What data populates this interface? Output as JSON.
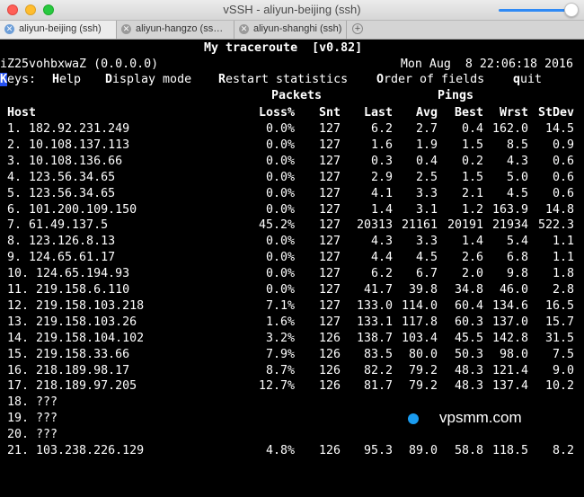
{
  "window": {
    "title": "vSSH - aliyun-beijing (ssh)",
    "tabs": [
      {
        "label": "aliyun-beijing (ssh)",
        "active": true
      },
      {
        "label": "aliyun-hangzo (ss…",
        "active": false
      },
      {
        "label": "aliyun-shanghi (ssh)",
        "active": false
      }
    ]
  },
  "terminal": {
    "heading": "My traceroute  [v0.82]",
    "host_line": "iZ25vohbxwaZ (0.0.0.0)",
    "datetime": "Mon Aug  8 22:06:18 2016",
    "keys": {
      "label_first": "K",
      "label_rest": "eys:",
      "help_key": "H",
      "help_rest": "elp",
      "display_key": "D",
      "display_rest": "isplay mode",
      "restart_key": "R",
      "restart_rest": "estart statistics",
      "order_key": "O",
      "order_rest": "rder of fields",
      "quit_key": "q",
      "quit_rest": "uit"
    },
    "group_headers": {
      "packets": "Packets",
      "pings": "Pings"
    },
    "columns": {
      "host": "Host",
      "loss": "Loss%",
      "snt": "Snt",
      "last": "Last",
      "avg": "Avg",
      "best": "Best",
      "wrst": "Wrst",
      "stdev": "StDev"
    },
    "hops": [
      {
        "host": "1. 182.92.231.249",
        "loss": "0.0%",
        "snt": "127",
        "last": "6.2",
        "avg": "2.7",
        "best": "0.4",
        "wrst": "162.0",
        "stdev": "14.5"
      },
      {
        "host": "2. 10.108.137.113",
        "loss": "0.0%",
        "snt": "127",
        "last": "1.6",
        "avg": "1.9",
        "best": "1.5",
        "wrst": "8.5",
        "stdev": "0.9"
      },
      {
        "host": "3. 10.108.136.66",
        "loss": "0.0%",
        "snt": "127",
        "last": "0.3",
        "avg": "0.4",
        "best": "0.2",
        "wrst": "4.3",
        "stdev": "0.6"
      },
      {
        "host": "4. 123.56.34.65",
        "loss": "0.0%",
        "snt": "127",
        "last": "2.9",
        "avg": "2.5",
        "best": "1.5",
        "wrst": "5.0",
        "stdev": "0.6"
      },
      {
        "host": "5. 123.56.34.65",
        "loss": "0.0%",
        "snt": "127",
        "last": "4.1",
        "avg": "3.3",
        "best": "2.1",
        "wrst": "4.5",
        "stdev": "0.6"
      },
      {
        "host": "6. 101.200.109.150",
        "loss": "0.0%",
        "snt": "127",
        "last": "1.4",
        "avg": "3.1",
        "best": "1.2",
        "wrst": "163.9",
        "stdev": "14.8"
      },
      {
        "host": "7. 61.49.137.5",
        "loss": "45.2%",
        "snt": "127",
        "last": "20313",
        "avg": "21161",
        "best": "20191",
        "wrst": "21934",
        "stdev": "522.3"
      },
      {
        "host": "8. 123.126.8.13",
        "loss": "0.0%",
        "snt": "127",
        "last": "4.3",
        "avg": "3.3",
        "best": "1.4",
        "wrst": "5.4",
        "stdev": "1.1"
      },
      {
        "host": "9. 124.65.61.17",
        "loss": "0.0%",
        "snt": "127",
        "last": "4.4",
        "avg": "4.5",
        "best": "2.6",
        "wrst": "6.8",
        "stdev": "1.1"
      },
      {
        "host": "10. 124.65.194.93",
        "loss": "0.0%",
        "snt": "127",
        "last": "6.2",
        "avg": "6.7",
        "best": "2.0",
        "wrst": "9.8",
        "stdev": "1.8"
      },
      {
        "host": "11. 219.158.6.110",
        "loss": "0.0%",
        "snt": "127",
        "last": "41.7",
        "avg": "39.8",
        "best": "34.8",
        "wrst": "46.0",
        "stdev": "2.8"
      },
      {
        "host": "12. 219.158.103.218",
        "loss": "7.1%",
        "snt": "127",
        "last": "133.0",
        "avg": "114.0",
        "best": "60.4",
        "wrst": "134.6",
        "stdev": "16.5"
      },
      {
        "host": "13. 219.158.103.26",
        "loss": "1.6%",
        "snt": "127",
        "last": "133.1",
        "avg": "117.8",
        "best": "60.3",
        "wrst": "137.0",
        "stdev": "15.7"
      },
      {
        "host": "14. 219.158.104.102",
        "loss": "3.2%",
        "snt": "126",
        "last": "138.7",
        "avg": "103.4",
        "best": "45.5",
        "wrst": "142.8",
        "stdev": "31.5"
      },
      {
        "host": "15. 219.158.33.66",
        "loss": "7.9%",
        "snt": "126",
        "last": "83.5",
        "avg": "80.0",
        "best": "50.3",
        "wrst": "98.0",
        "stdev": "7.5"
      },
      {
        "host": "16. 218.189.98.17",
        "loss": "8.7%",
        "snt": "126",
        "last": "82.2",
        "avg": "79.2",
        "best": "48.3",
        "wrst": "121.4",
        "stdev": "9.0"
      },
      {
        "host": "17. 218.189.97.205",
        "loss": "12.7%",
        "snt": "126",
        "last": "81.7",
        "avg": "79.2",
        "best": "48.3",
        "wrst": "137.4",
        "stdev": "10.2"
      },
      {
        "host": "18. ???",
        "loss": "",
        "snt": "",
        "last": "",
        "avg": "",
        "best": "",
        "wrst": "",
        "stdev": ""
      },
      {
        "host": "19. ???",
        "loss": "",
        "snt": "",
        "last": "",
        "avg": "",
        "best": "",
        "wrst": "",
        "stdev": ""
      },
      {
        "host": "20. ???",
        "loss": "",
        "snt": "",
        "last": "",
        "avg": "",
        "best": "",
        "wrst": "",
        "stdev": ""
      },
      {
        "host": "21. 103.238.226.129",
        "loss": "4.8%",
        "snt": "126",
        "last": "95.3",
        "avg": "89.0",
        "best": "58.8",
        "wrst": "118.5",
        "stdev": "8.2"
      }
    ],
    "watermark": "vpsmm.com"
  },
  "colors": {
    "cursor": "#2450f0",
    "watermark_dot": "#1a9cf0",
    "tab_active_icon": "#6e9fd8"
  }
}
